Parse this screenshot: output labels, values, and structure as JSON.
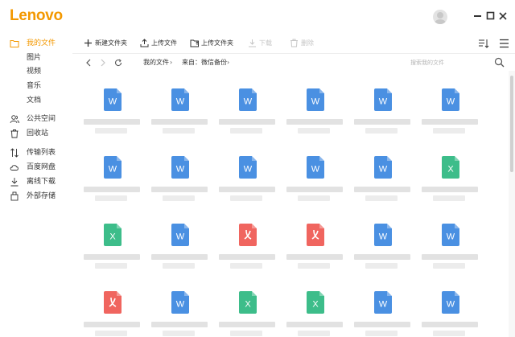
{
  "app": {
    "logo": "Lenovo",
    "brand_color": "#f39800"
  },
  "window": {
    "controls": [
      "minimize-icon",
      "maximize-icon",
      "close-icon"
    ]
  },
  "sidebar": {
    "my_files": "我的文件",
    "sub_items": [
      "图片",
      "视频",
      "音乐",
      "文档"
    ],
    "public_space": "公共空间",
    "recycle_bin": "回收站",
    "transfer_list": "传输列表",
    "baidu_disk": "百度网盘",
    "offline_download": "离线下载",
    "external_storage": "外部存储"
  },
  "toolbar": {
    "new_folder": "新建文件夹",
    "upload_file": "上传文件",
    "upload_folder": "上传文件夹",
    "download": "下载",
    "delete": "删除"
  },
  "nav": {
    "breadcrumbs": [
      "我的文件",
      "来自：微信备份"
    ],
    "search_placeholder": "搜索我的文件"
  },
  "files": [
    "word",
    "word",
    "word",
    "word",
    "word",
    "word",
    "word",
    "word",
    "word",
    "word",
    "word",
    "excel",
    "excel",
    "word",
    "pdf",
    "pdf",
    "word",
    "word",
    "pdf",
    "word",
    "excel",
    "excel",
    "word",
    "word"
  ],
  "colors": {
    "word": "#4a90e2",
    "excel": "#3dbd8a",
    "pdf": "#f0655f",
    "accent": "#f39800"
  }
}
